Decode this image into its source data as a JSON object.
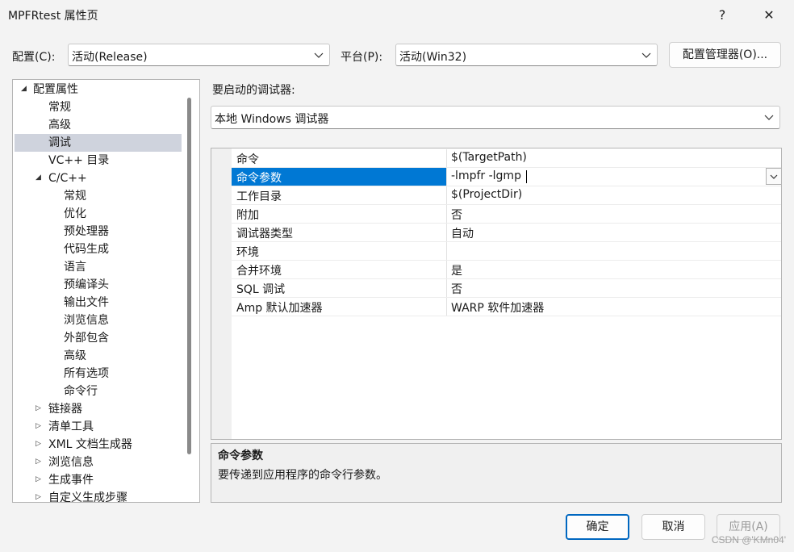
{
  "window": {
    "title": "MPFRtest 属性页",
    "help_glyph": "?",
    "close_glyph": "✕"
  },
  "config_row": {
    "config_label": "配置(C):",
    "config_value": "活动(Release)",
    "platform_label": "平台(P):",
    "platform_value": "活动(Win32)",
    "manager_button": "配置管理器(O)..."
  },
  "tree": {
    "items": [
      {
        "label": "配置属性",
        "expander": "◢"
      },
      {
        "label": "常规"
      },
      {
        "label": "高级"
      },
      {
        "label": "调试",
        "selected": true
      },
      {
        "label": "VC++ 目录"
      },
      {
        "label": "C/C++",
        "expander": "◢"
      },
      {
        "label": "常规"
      },
      {
        "label": "优化"
      },
      {
        "label": "预处理器"
      },
      {
        "label": "代码生成"
      },
      {
        "label": "语言"
      },
      {
        "label": "预编译头"
      },
      {
        "label": "输出文件"
      },
      {
        "label": "浏览信息"
      },
      {
        "label": "外部包含"
      },
      {
        "label": "高级"
      },
      {
        "label": "所有选项"
      },
      {
        "label": "命令行"
      },
      {
        "label": "链接器",
        "expander": "▷"
      },
      {
        "label": "清单工具",
        "expander": "▷"
      },
      {
        "label": "XML 文档生成器",
        "expander": "▷"
      },
      {
        "label": "浏览信息",
        "expander": "▷"
      },
      {
        "label": "生成事件",
        "expander": "▷"
      },
      {
        "label": "自定义生成步骤",
        "expander": "▷"
      }
    ]
  },
  "debugger": {
    "label": "要启动的调试器:",
    "value": "本地 Windows 调试器"
  },
  "properties": [
    {
      "name": "命令",
      "value": "$(TargetPath)"
    },
    {
      "name": "命令参数",
      "value": "-lmpfr -lgmp",
      "selected": true
    },
    {
      "name": "工作目录",
      "value": "$(ProjectDir)"
    },
    {
      "name": "附加",
      "value": "否"
    },
    {
      "name": "调试器类型",
      "value": "自动"
    },
    {
      "name": "环境",
      "value": ""
    },
    {
      "name": "合并环境",
      "value": "是"
    },
    {
      "name": "SQL 调试",
      "value": "否"
    },
    {
      "name": "Amp 默认加速器",
      "value": "WARP 软件加速器"
    }
  ],
  "description": {
    "title": "命令参数",
    "text": "要传递到应用程序的命令行参数。"
  },
  "buttons": {
    "ok": "确定",
    "cancel": "取消",
    "apply": "应用(A)"
  },
  "watermark": "CSDN @'KMn04'",
  "colors": {
    "selection_blue": "#0078d4",
    "tree_selection": "#cfd3dd",
    "ok_border": "#0067c0"
  }
}
